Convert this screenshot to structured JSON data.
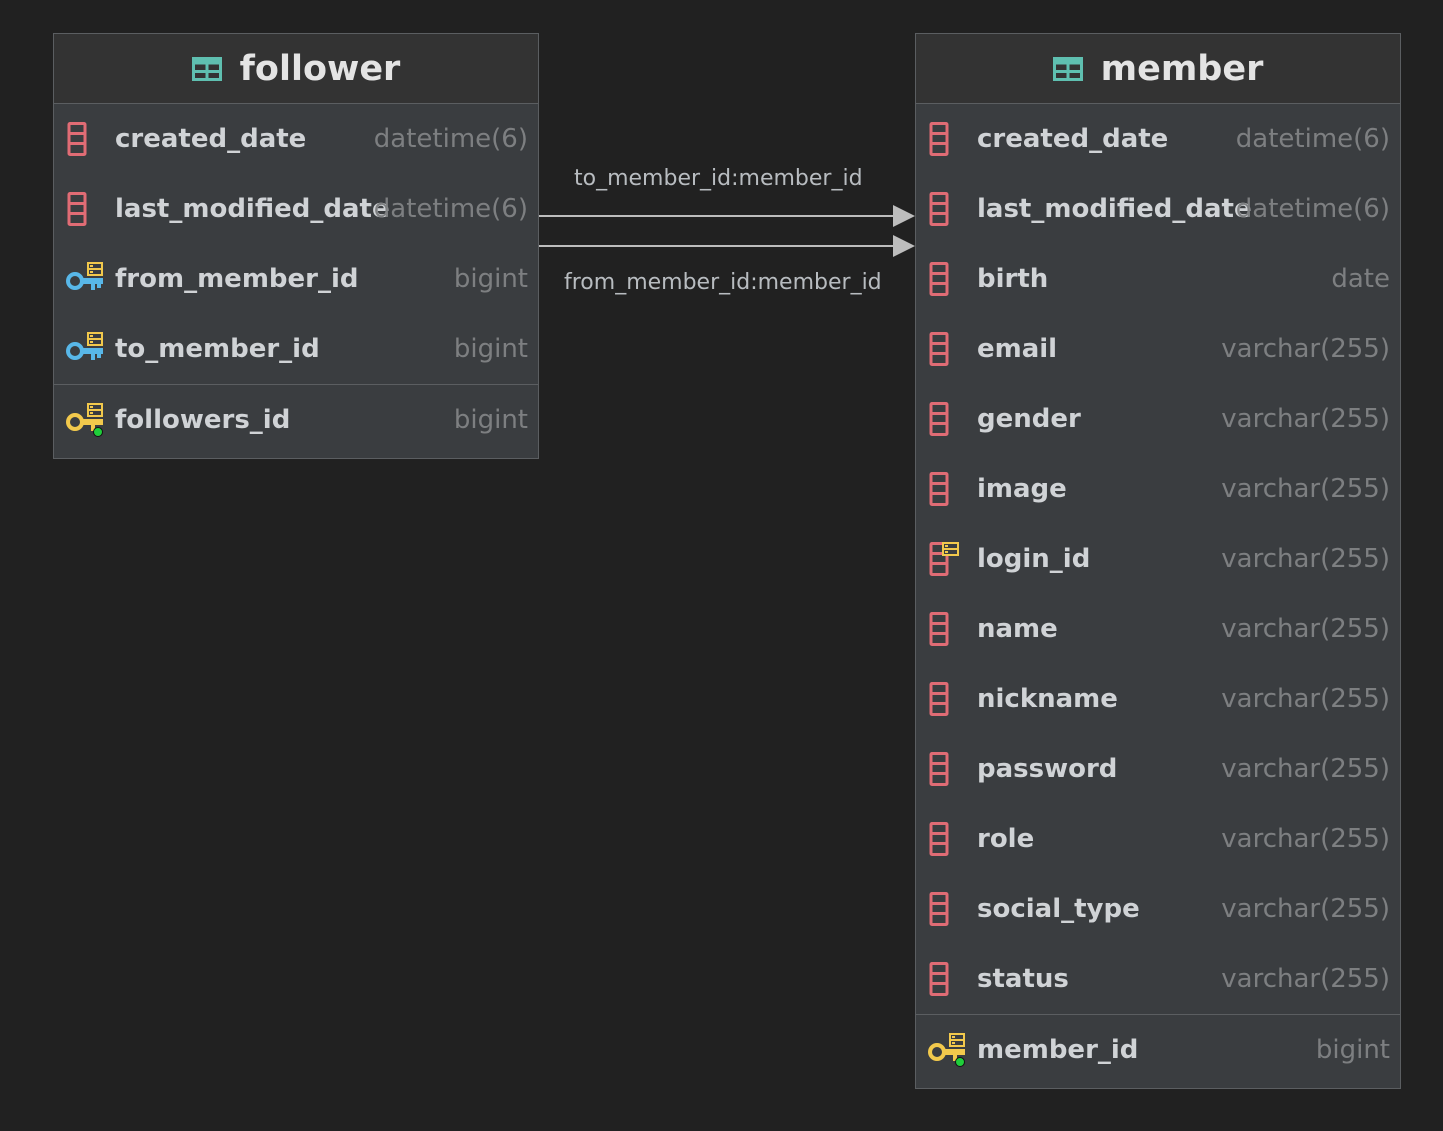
{
  "colors": {
    "background": "#212121",
    "table_body": "#3a3d40",
    "table_header": "#333333",
    "column_icon": "#e06c75",
    "fk_key": "#58b7e8",
    "pk_key": "#f2c94c",
    "table_icon": "#5fbfb0",
    "arrow": "#bdbdbd"
  },
  "follower": {
    "title": "follower",
    "icon": "table-icon",
    "columns": [
      {
        "name": "created_date",
        "type": "datetime(6)",
        "icon": "column-icon"
      },
      {
        "name": "last_modified_date",
        "type": "datetime(6)",
        "icon": "column-icon"
      },
      {
        "name": "from_member_id",
        "type": "bigint",
        "icon": "foreign-key-icon"
      },
      {
        "name": "to_member_id",
        "type": "bigint",
        "icon": "foreign-key-icon"
      }
    ],
    "primary_key": {
      "name": "followers_id",
      "type": "bigint",
      "icon": "primary-key-icon"
    }
  },
  "member": {
    "title": "member",
    "icon": "table-icon",
    "columns": [
      {
        "name": "created_date",
        "type": "datetime(6)",
        "icon": "column-icon"
      },
      {
        "name": "last_modified_date",
        "type": "datetime(6)",
        "icon": "column-icon"
      },
      {
        "name": "birth",
        "type": "date",
        "icon": "column-icon"
      },
      {
        "name": "email",
        "type": "varchar(255)",
        "icon": "column-icon"
      },
      {
        "name": "gender",
        "type": "varchar(255)",
        "icon": "column-icon"
      },
      {
        "name": "image",
        "type": "varchar(255)",
        "icon": "column-icon"
      },
      {
        "name": "login_id",
        "type": "varchar(255)",
        "icon": "unique-column-icon"
      },
      {
        "name": "name",
        "type": "varchar(255)",
        "icon": "column-icon"
      },
      {
        "name": "nickname",
        "type": "varchar(255)",
        "icon": "column-icon"
      },
      {
        "name": "password",
        "type": "varchar(255)",
        "icon": "column-icon"
      },
      {
        "name": "role",
        "type": "varchar(255)",
        "icon": "column-icon"
      },
      {
        "name": "social_type",
        "type": "varchar(255)",
        "icon": "column-icon"
      },
      {
        "name": "status",
        "type": "varchar(255)",
        "icon": "column-icon"
      }
    ],
    "primary_key": {
      "name": "member_id",
      "type": "bigint",
      "icon": "primary-key-icon"
    }
  },
  "relations": [
    {
      "label": "to_member_id:member_id",
      "from": "follower.to_member_id",
      "to": "member.member_id"
    },
    {
      "label": "from_member_id:member_id",
      "from": "follower.from_member_id",
      "to": "member.member_id"
    }
  ]
}
